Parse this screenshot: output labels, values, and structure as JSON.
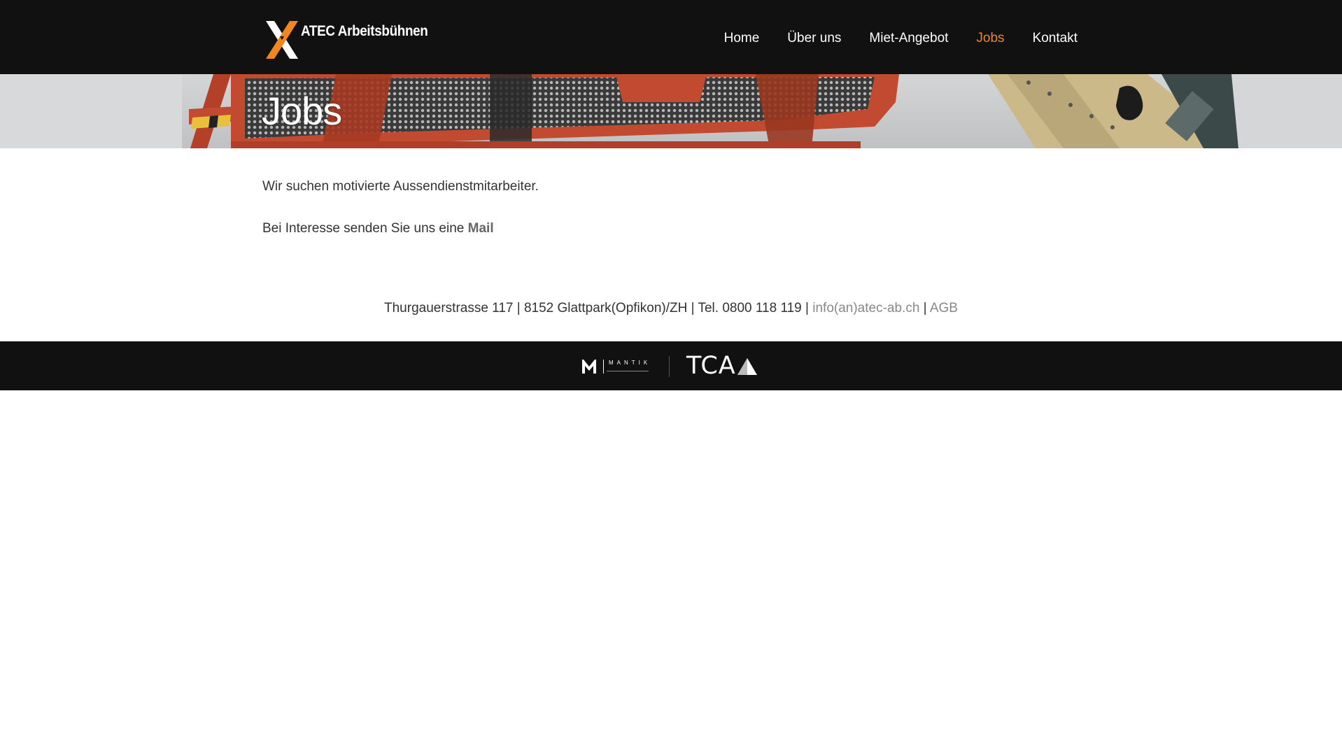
{
  "header": {
    "logo_text": "ATEC Arbeitsbühnen",
    "nav": [
      {
        "label": "Home"
      },
      {
        "label": "Über uns"
      },
      {
        "label": "Miet-Angebot"
      },
      {
        "label": "Jobs"
      },
      {
        "label": "Kontakt"
      }
    ],
    "active_nav": "Jobs"
  },
  "hero": {
    "title": "Jobs"
  },
  "content": {
    "paragraph1": "Wir suchen motivierte Aussendienstmitarbeiter.",
    "paragraph2_prefix": "Bei Interesse senden Sie uns eine ",
    "mail_link": "Mail"
  },
  "contact": {
    "address": "Thurgauerstrasse 117 | 8152 Glattpark(Opfikon)/ZH | Tel. 0800 118 119",
    "separator": " | ",
    "email_link": "info(an)atec-ab.ch",
    "agb_link": "AGB"
  },
  "footer": {
    "mantik_text": "MANTIK",
    "tca_text": "TCA"
  },
  "colors": {
    "header_bg": "#111111",
    "accent_orange": "#f0861f",
    "text": "#333333",
    "link_gray": "#888888"
  },
  "icons": [
    "atec-x-logo-icon",
    "mantik-m-icon",
    "tca-triangle-icon"
  ]
}
